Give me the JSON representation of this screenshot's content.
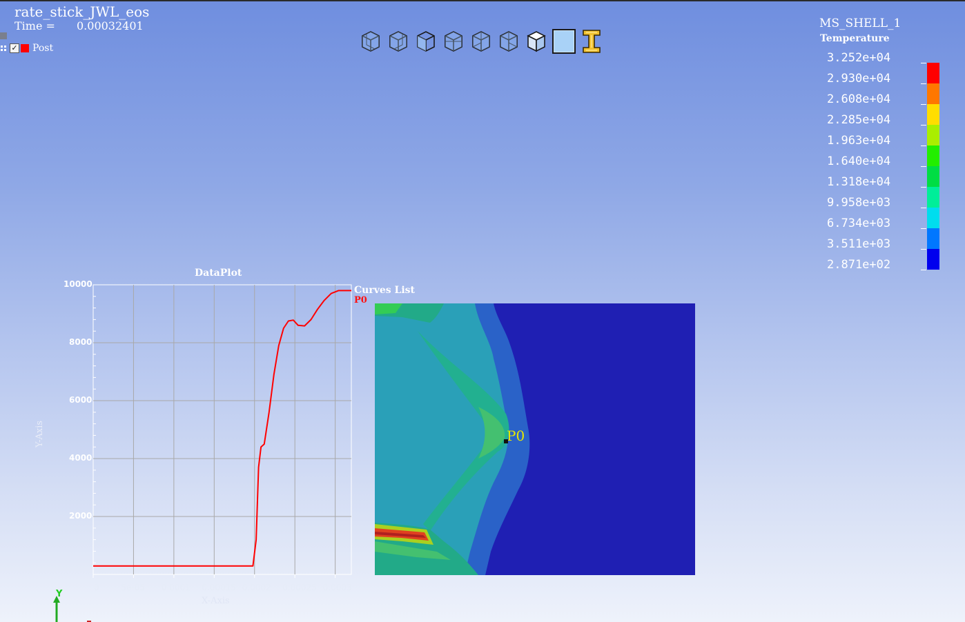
{
  "header": {
    "title": "rate_stick_JWL_eos",
    "time_label": "Time =",
    "time_value": "0.00032401"
  },
  "tree": {
    "post_label": "Post",
    "post_checked": true,
    "post_color": "#ff0000"
  },
  "toolbar": {
    "buttons": [
      {
        "name": "view-front-icon"
      },
      {
        "name": "view-back-icon"
      },
      {
        "name": "view-left-icon"
      },
      {
        "name": "view-right-icon"
      },
      {
        "name": "view-top-icon"
      },
      {
        "name": "view-bottom-icon"
      },
      {
        "name": "view-iso-icon"
      },
      {
        "name": "view-fit-icon"
      },
      {
        "name": "section-beam-icon"
      }
    ]
  },
  "legend": {
    "part_name": "MS_SHELL_1",
    "variable": "Temperature",
    "labels": [
      "3.252e+04",
      "2.930e+04",
      "2.608e+04",
      "2.285e+04",
      "1.963e+04",
      "1.640e+04",
      "1.318e+04",
      "9.958e+03",
      "6.734e+03",
      "3.511e+03",
      "2.871e+02"
    ],
    "colors": [
      "#ff0000",
      "#ff7700",
      "#ffdd00",
      "#aaee00",
      "#22ee00",
      "#00dd44",
      "#00ee99",
      "#00ddee",
      "#0077ff",
      "#0000ee"
    ]
  },
  "plot": {
    "title": "DataPlot",
    "curves_title": "Curves List",
    "curve_name": "P0",
    "x_axis_label": "X-Axis",
    "y_axis_label": "Y-Axis"
  },
  "chart_data": {
    "type": "line",
    "title": "DataPlot",
    "xlabel": "X-Axis",
    "ylabel": "Y-Axis",
    "xlim": [
      0,
      0.00032
    ],
    "ylim": [
      0,
      10000
    ],
    "x_ticks": [
      "0",
      "5e-05",
      "0.0001",
      "0.00015",
      "0.0002",
      "0.00025",
      "0.0003"
    ],
    "y_ticks": [
      "10000",
      "8000",
      "6000",
      "4000",
      "2000"
    ],
    "grid": true,
    "legend": "right",
    "series": [
      {
        "name": "P0",
        "color": "#ff0000",
        "x": [
          0,
          5e-05,
          0.0001,
          0.00015,
          0.000198,
          0.000202,
          0.000205,
          0.000208,
          0.000212,
          0.000218,
          0.000224,
          0.00023,
          0.000236,
          0.000242,
          0.000248,
          0.000254,
          0.000262,
          0.00027,
          0.000278,
          0.000286,
          0.000295,
          0.000304,
          0.00031,
          0.00032
        ],
        "y": [
          290,
          290,
          290,
          290,
          290,
          1200,
          3700,
          4400,
          4500,
          5600,
          6900,
          7900,
          8500,
          8750,
          8780,
          8600,
          8580,
          8800,
          9150,
          9450,
          9700,
          9800,
          9800,
          9800
        ]
      }
    ]
  },
  "probe": {
    "label": "P0"
  },
  "triad": {
    "y_label": "Y"
  }
}
